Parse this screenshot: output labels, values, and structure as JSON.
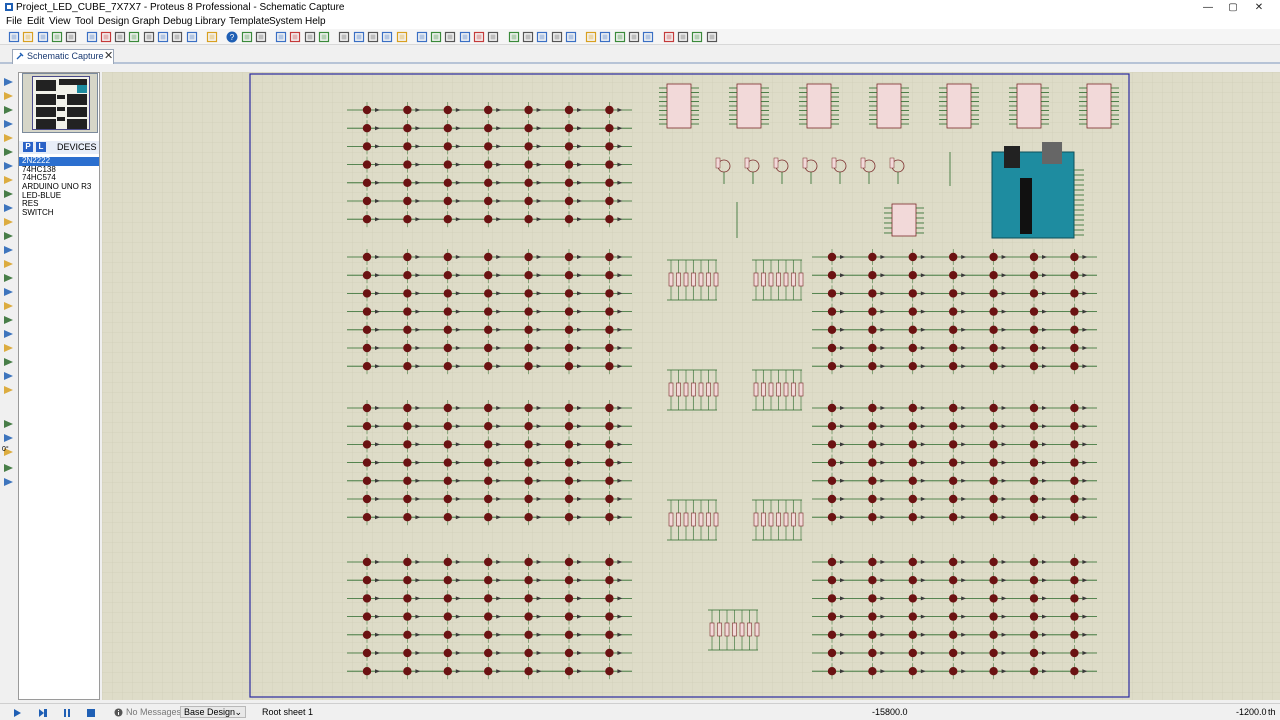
{
  "window": {
    "title": "Project_LED_CUBE_7X7X7 - Proteus 8 Professional - Schematic Capture",
    "minimize": "—",
    "maximize": "▢",
    "close": "✕"
  },
  "menu": [
    "File",
    "Edit",
    "View",
    "Tool",
    "Design",
    "Graph",
    "Debug",
    "Library",
    "Template",
    "System",
    "Help"
  ],
  "tab": {
    "label": "Schematic Capture",
    "close": "✕"
  },
  "selector": {
    "p_button": "P",
    "l_button": "L",
    "heading": "DEVICES",
    "devices": [
      "2N2222",
      "74HC138",
      "74HC574",
      "ARDUINO UNO R3",
      "LED-BLUE",
      "RES",
      "SWITCH"
    ],
    "selected": "2N2222"
  },
  "rotation": {
    "angle": "0°"
  },
  "status": {
    "messages": "No Messages",
    "design": "Base Design",
    "sheet": "Root sheet 1",
    "coord_x": "-15800.0",
    "coord_y": "-1200.0",
    "unit": "th"
  },
  "colors": {
    "canvas": "#dedcc8",
    "sheet_border": "#2a2aa0",
    "led": "#6b1212",
    "wire": "#2a6a2a",
    "chip": "#f2d9d9",
    "arduino": "#1e8ca0"
  }
}
